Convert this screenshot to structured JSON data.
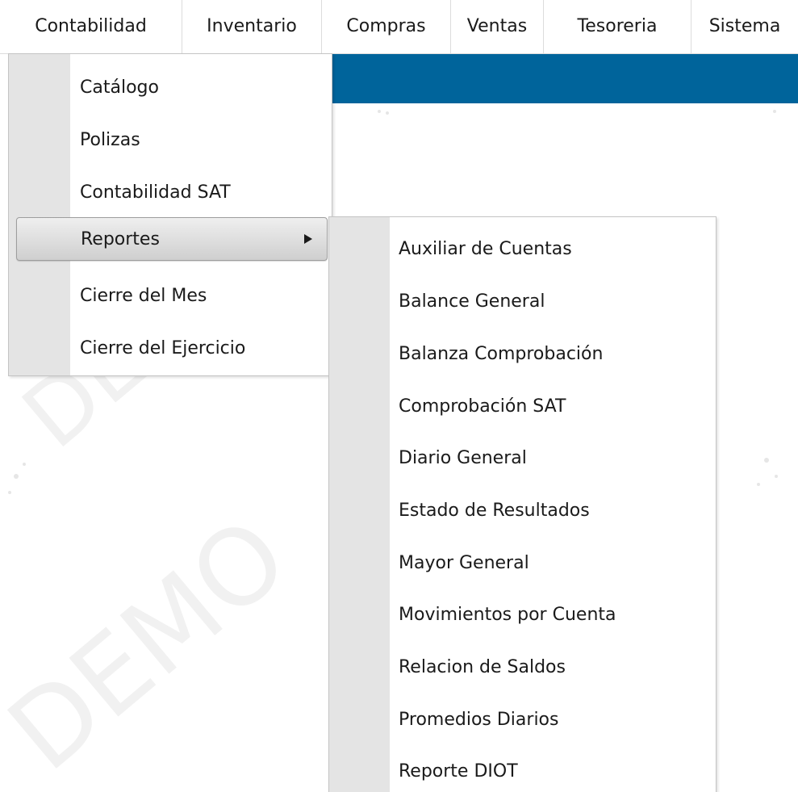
{
  "menubar": {
    "items": [
      {
        "label": "Contabilidad"
      },
      {
        "label": "Inventario"
      },
      {
        "label": "Compras"
      },
      {
        "label": "Ventas"
      },
      {
        "label": "Tesoreria"
      },
      {
        "label": "Sistema"
      }
    ]
  },
  "watermark": {
    "text": "DEMO"
  },
  "contabilidad_menu": {
    "items": [
      {
        "label": "Catálogo"
      },
      {
        "label": "Polizas"
      },
      {
        "label": "Contabilidad SAT"
      },
      {
        "label": "Reportes"
      },
      {
        "label": "Cierre del Mes"
      },
      {
        "label": "Cierre del Ejercicio"
      }
    ]
  },
  "reportes_submenu": {
    "items": [
      {
        "label": "Auxiliar de Cuentas"
      },
      {
        "label": "Balance General"
      },
      {
        "label": "Balanza Comprobación"
      },
      {
        "label": "Comprobación SAT"
      },
      {
        "label": "Diario General"
      },
      {
        "label": "Estado de Resultados"
      },
      {
        "label": "Mayor General"
      },
      {
        "label": "Movimientos por Cuenta"
      },
      {
        "label": "Relacion de Saldos"
      },
      {
        "label": "Promedios Diarios"
      },
      {
        "label": "Reporte DIOT"
      }
    ]
  },
  "colors": {
    "header_band": "#00649b",
    "gutter": "#e4e4e4",
    "highlight_start": "#efefef",
    "highlight_end": "#cfcfcf"
  }
}
